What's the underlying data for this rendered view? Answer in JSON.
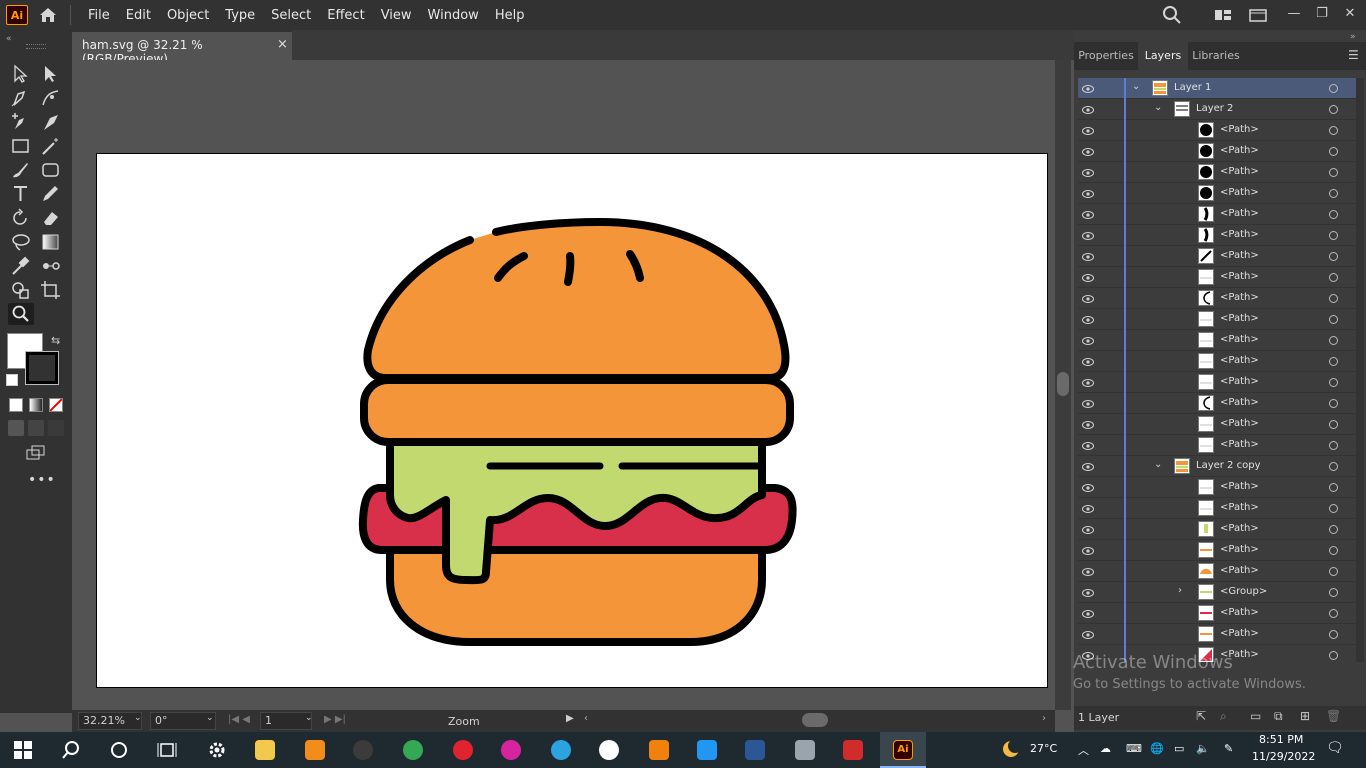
{
  "app": {
    "logo": "Ai",
    "name": "Adobe Illustrator"
  },
  "menu": [
    "File",
    "Edit",
    "Object",
    "Type",
    "Select",
    "Effect",
    "View",
    "Window",
    "Help"
  ],
  "document": {
    "tab_title": "ham.svg @ 32.21 % (RGB/Preview)",
    "close": "×"
  },
  "status": {
    "zoom": "32.21%",
    "rotation": "0°",
    "artboard": "1",
    "tool": "Zoom"
  },
  "panel": {
    "tabs": [
      "Properties",
      "Layers",
      "Libraries"
    ],
    "active_tab": "Layers",
    "footer_label": "1 Layer",
    "rows": [
      {
        "name": "Layer 1",
        "level": 0,
        "chev": "⌄",
        "selected": true,
        "thumb": "burger"
      },
      {
        "name": "Layer 2",
        "level": 1,
        "chev": "⌄",
        "thumb": "lines"
      },
      {
        "name": "<Path>",
        "level": 2,
        "thumb": "circle"
      },
      {
        "name": "<Path>",
        "level": 2,
        "thumb": "circle"
      },
      {
        "name": "<Path>",
        "level": 2,
        "thumb": "circle"
      },
      {
        "name": "<Path>",
        "level": 2,
        "thumb": "circle"
      },
      {
        "name": "<Path>",
        "level": 2,
        "thumb": "stroke"
      },
      {
        "name": "<Path>",
        "level": 2,
        "thumb": "stroke"
      },
      {
        "name": "<Path>",
        "level": 2,
        "thumb": "diag"
      },
      {
        "name": "<Path>",
        "level": 2,
        "thumb": "blank"
      },
      {
        "name": "<Path>",
        "level": 2,
        "thumb": "arc"
      },
      {
        "name": "<Path>",
        "level": 2,
        "thumb": "blank"
      },
      {
        "name": "<Path>",
        "level": 2,
        "thumb": "blank"
      },
      {
        "name": "<Path>",
        "level": 2,
        "thumb": "blank"
      },
      {
        "name": "<Path>",
        "level": 2,
        "thumb": "blank"
      },
      {
        "name": "<Path>",
        "level": 2,
        "thumb": "arc"
      },
      {
        "name": "<Path>",
        "level": 2,
        "thumb": "blank"
      },
      {
        "name": "<Path>",
        "level": 2,
        "thumb": "blank"
      },
      {
        "name": "Layer 2 copy",
        "level": 1,
        "chev": "⌄",
        "thumb": "burger"
      },
      {
        "name": "<Path>",
        "level": 2,
        "thumb": "blank"
      },
      {
        "name": "<Path>",
        "level": 2,
        "thumb": "blank"
      },
      {
        "name": "<Path>",
        "level": 2,
        "thumb": "green"
      },
      {
        "name": "<Path>",
        "level": 2,
        "thumb": "orange-line"
      },
      {
        "name": "<Path>",
        "level": 2,
        "thumb": "orange-arc"
      },
      {
        "name": "<Group>",
        "level": 2,
        "chev": "›",
        "thumb": "green-line"
      },
      {
        "name": "<Path>",
        "level": 2,
        "thumb": "red-line"
      },
      {
        "name": "<Path>",
        "level": 2,
        "thumb": "orange-line"
      },
      {
        "name": "<Path>",
        "level": 2,
        "thumb": "red"
      }
    ]
  },
  "watermark": {
    "line1": "Activate Windows",
    "line2": "Go to Settings to activate Windows."
  },
  "taskbar": {
    "weather": "27°C",
    "time": "8:51 PM",
    "date": "11/29/2022",
    "apps": [
      {
        "name": "windows-start",
        "color": "#ffffff"
      },
      {
        "name": "search",
        "color": "#ffffff"
      },
      {
        "name": "cortana",
        "color": "#ffffff"
      },
      {
        "name": "task-view",
        "color": "#ffffff"
      },
      {
        "name": "settings",
        "color": "#ffffff"
      },
      {
        "name": "file-explorer",
        "color": "#f2c94c"
      },
      {
        "name": "vlc",
        "color": "#f28c1b"
      },
      {
        "name": "obs",
        "color": "#3b3b3b"
      },
      {
        "name": "chrome",
        "color": "#34a853"
      },
      {
        "name": "opera",
        "color": "#e0232e"
      },
      {
        "name": "instagram",
        "color": "#d6249f"
      },
      {
        "name": "telegram",
        "color": "#2aa3df"
      },
      {
        "name": "app-c",
        "color": "#ffffff"
      },
      {
        "name": "blender",
        "color": "#f2800d"
      },
      {
        "name": "app-h",
        "color": "#2196f3"
      },
      {
        "name": "word",
        "color": "#2b5797"
      },
      {
        "name": "calculator",
        "color": "#9aa4ad"
      },
      {
        "name": "app-s",
        "color": "#d12b2b"
      },
      {
        "name": "illustrator",
        "color": "#ff9a00"
      }
    ]
  },
  "colors": {
    "bun": "#f5953a",
    "lettuce": "#c2d970",
    "tomato": "#d8304a",
    "outline": "#000000"
  }
}
